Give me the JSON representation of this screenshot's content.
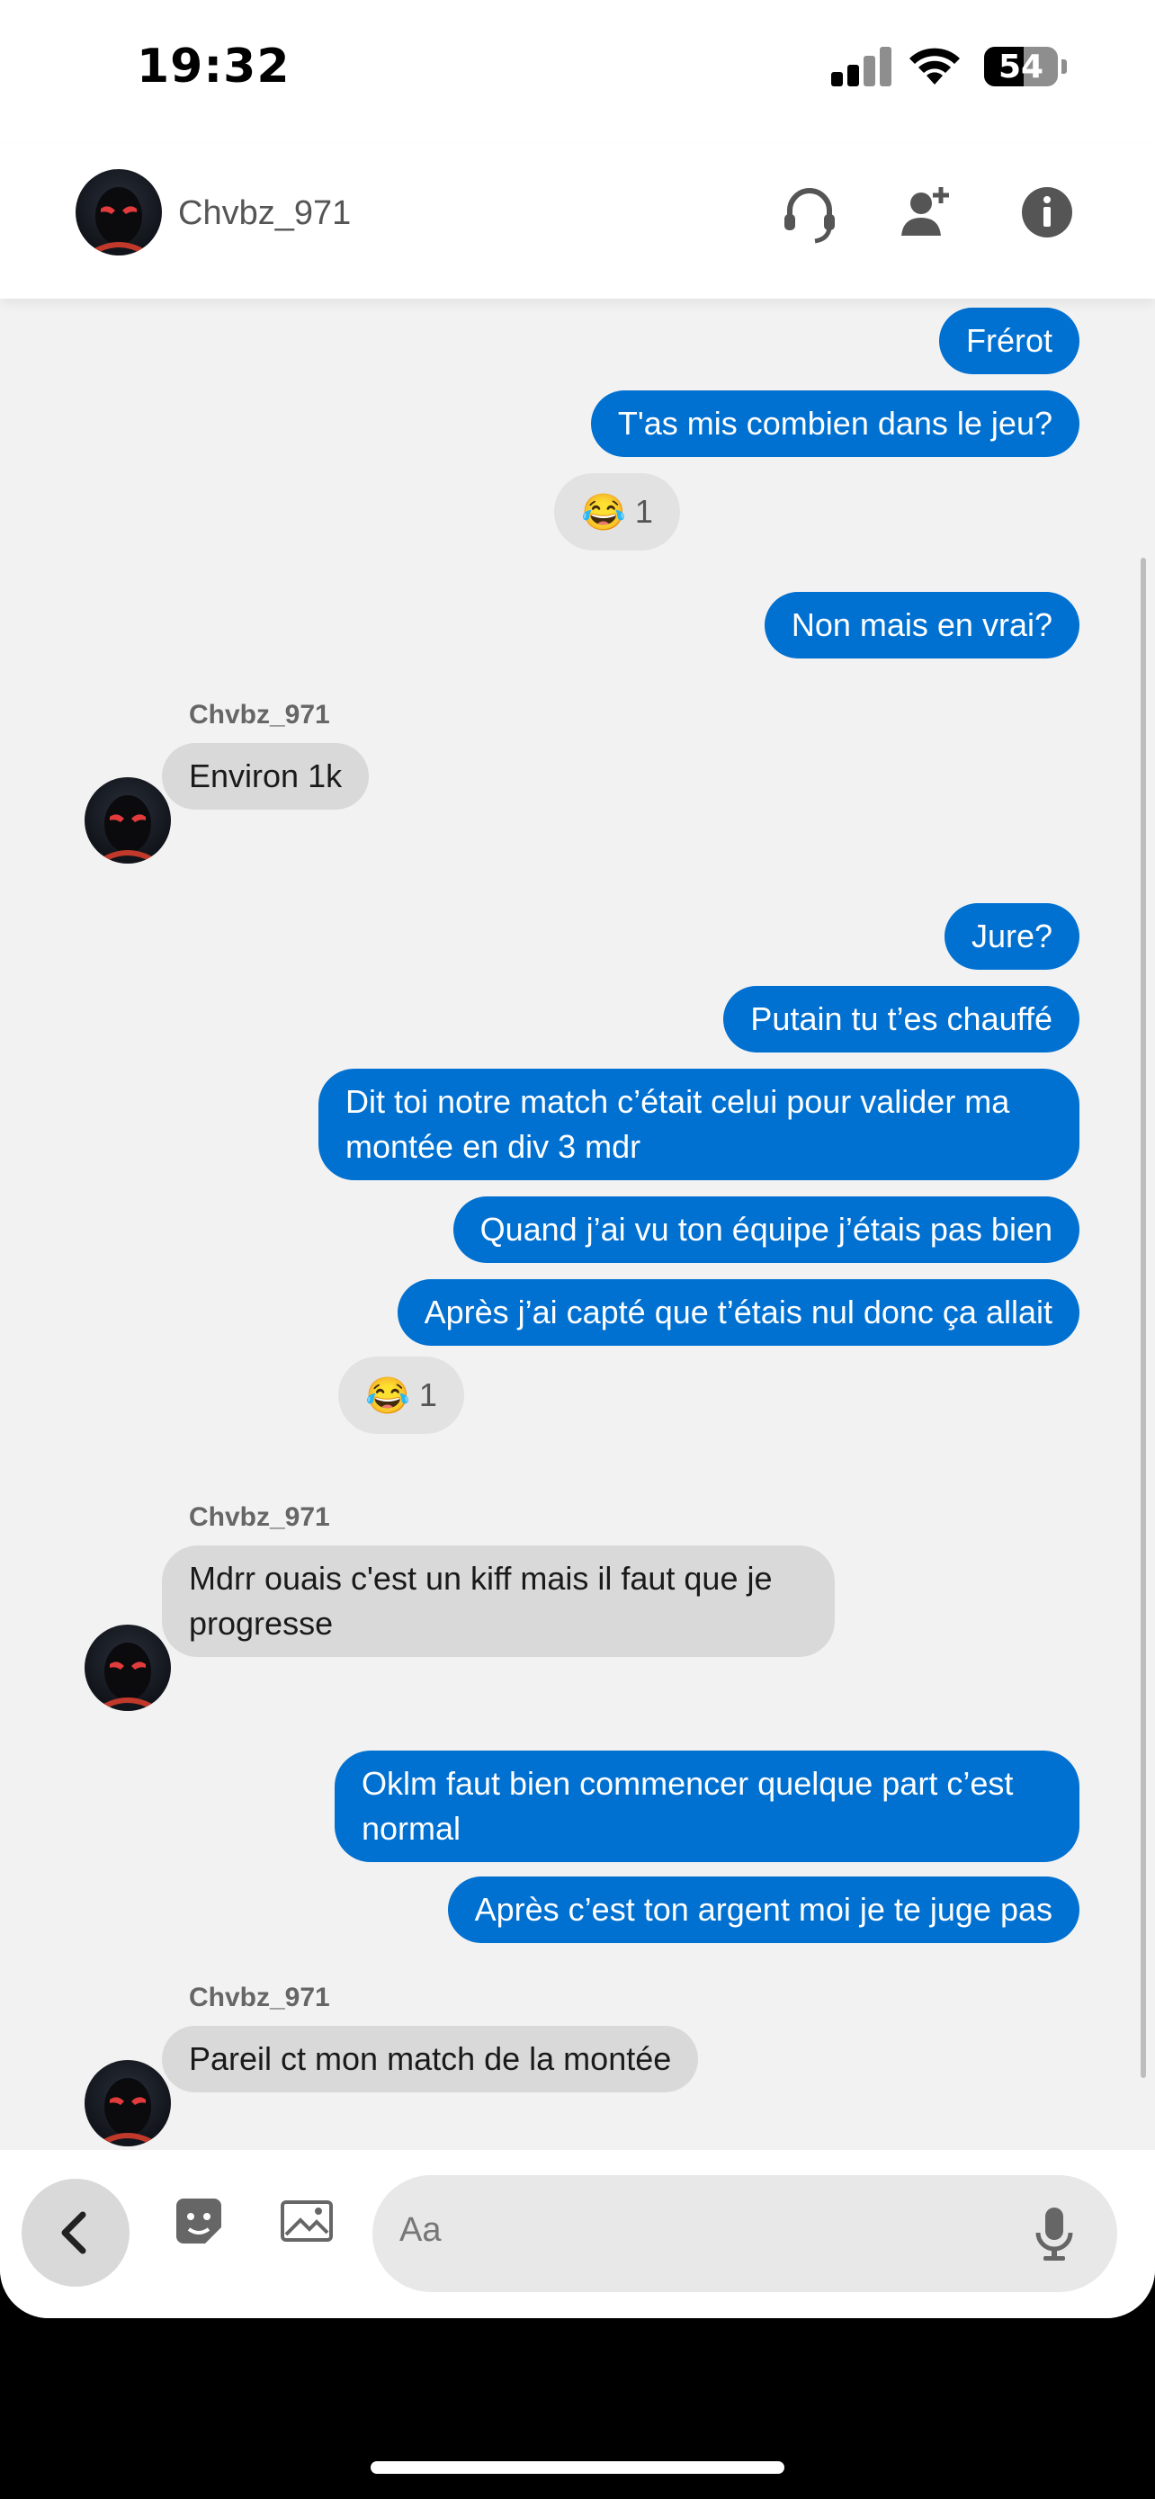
{
  "status_bar": {
    "time": "19:32",
    "battery": "54"
  },
  "header": {
    "contact_name": "Chvbz_971",
    "icons": [
      "headset-icon",
      "add-friend-icon",
      "info-icon"
    ]
  },
  "messages": [
    {
      "dir": "out",
      "text": "Frérot"
    },
    {
      "dir": "out",
      "text": "T'as mis combien dans le jeu?"
    },
    {
      "reaction": {
        "emoji": "😂",
        "count": "1"
      }
    },
    {
      "dir": "out",
      "text": "Non mais en vrai?"
    },
    {
      "sender": "Chvbz_971"
    },
    {
      "dir": "in",
      "text": "Environ 1k"
    },
    {
      "dir": "out",
      "text": "Jure?"
    },
    {
      "dir": "out",
      "text": "Putain tu t’es chauffé"
    },
    {
      "dir": "out",
      "text": "Dit toi notre match c’était celui pour valider ma montée en div 3 mdr"
    },
    {
      "dir": "out",
      "text": "Quand j’ai vu ton équipe j’étais pas bien"
    },
    {
      "dir": "out",
      "text": "Après j’ai capté que t’étais nul donc ça allait"
    },
    {
      "reaction": {
        "emoji": "😂",
        "count": "1"
      }
    },
    {
      "sender": "Chvbz_971"
    },
    {
      "dir": "in",
      "text": "Mdrr ouais c'est un kiff mais il faut que je progresse"
    },
    {
      "dir": "out",
      "text": "Oklm faut bien commencer quelque part c’est normal"
    },
    {
      "dir": "out",
      "text": "Après c’est ton argent moi je te juge pas"
    },
    {
      "sender": "Chvbz_971"
    },
    {
      "dir": "in",
      "text": "Pareil ct mon match de la montée"
    }
  ],
  "composer": {
    "placeholder": "Aa"
  },
  "colors": {
    "outgoing": "#0070d1",
    "incoming": "#d9d9d9",
    "background": "#f2f2f2"
  }
}
